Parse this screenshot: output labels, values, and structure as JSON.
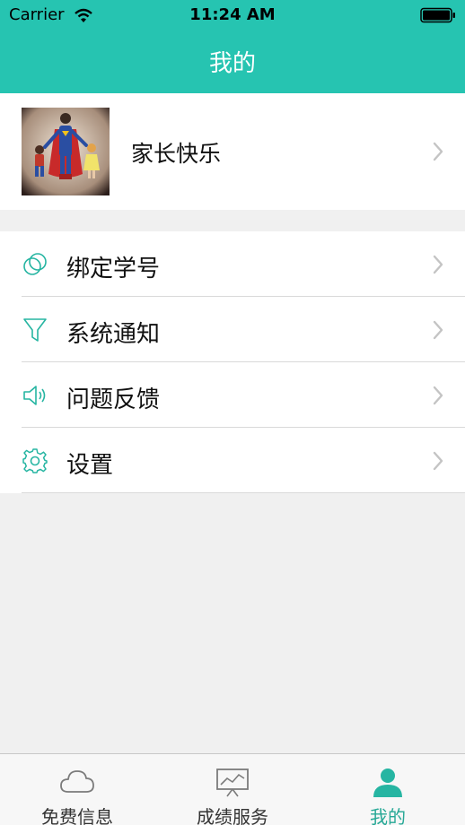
{
  "status_bar": {
    "carrier": "Carrier",
    "time": "11:24 AM",
    "wifi_icon": "wifi-icon",
    "battery_icon": "battery-icon"
  },
  "nav": {
    "title": "我的"
  },
  "profile": {
    "name": "家长快乐",
    "avatar": "superhero-parent-avatar"
  },
  "menu": {
    "items": [
      {
        "label": "绑定学号",
        "icon": "circles-icon"
      },
      {
        "label": "系统通知",
        "icon": "funnel-icon"
      },
      {
        "label": "问题反馈",
        "icon": "speaker-icon"
      },
      {
        "label": "设置",
        "icon": "gear-icon"
      }
    ]
  },
  "tab_bar": {
    "tabs": [
      {
        "label": "免费信息",
        "icon": "cloud-icon",
        "active": false
      },
      {
        "label": "成绩服务",
        "icon": "chart-board-icon",
        "active": false
      },
      {
        "label": "我的",
        "icon": "person-icon",
        "active": true
      }
    ]
  },
  "colors": {
    "accent": "#26c4b1",
    "tab_active": "#26a896",
    "background": "#f0f0f0"
  }
}
